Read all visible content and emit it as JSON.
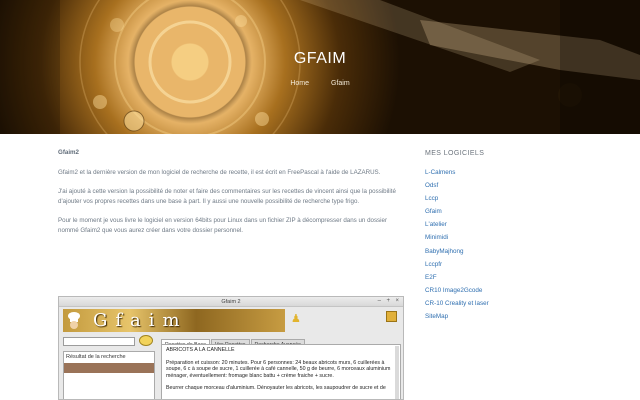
{
  "site": {
    "hero_title": "GFAIM",
    "breadcrumb": {
      "home": "Home",
      "current": "Gfaim"
    }
  },
  "post": {
    "title": "Gfaim2",
    "p1": "Gfaim2 et la dernière version de mon logiciel de recherche de recette, il est écrit en FreePascal à l'aide de LAZARUS.",
    "p2": "J'ai ajouté à cette version la possibilité de noter et faire des commentaires sur les recettes de vincent ainsi que la possibilité d'ajouter vos propres recettes dans une base à part. Il y aussi une nouvelle possibilité de recherche type frigo.",
    "p3": "Pour le moment je vous livre le logiciel en version 64bits pour Linux dans un fichier ZIP à décompresser dans un dossier nommé Gfaim2 que vous aurez créer dans votre dossier personnel."
  },
  "sidebar": {
    "heading": "MES LOGICIELS",
    "items": [
      "L-Calmens",
      "Odsf",
      "Lccp",
      "Gfaim",
      "L'atelier",
      "Minimidi",
      "BabyMajhong",
      "Lccpfr",
      "E2F",
      "CR10 Image2Gcode",
      "CR-10 Creality et laser",
      "SiteMap"
    ]
  },
  "app": {
    "window_title": "Gfaim 2",
    "window_controls": [
      "–",
      "+",
      "×"
    ],
    "banner_text": "Gfaim",
    "tabs": [
      "Recettes de Base",
      "Vos Recettes",
      "Recherche Avancée"
    ],
    "result_header": "Résultat de la recherche",
    "recipe_title": "ABRICOTS A LA CANNELLE",
    "recipe_p1": "Préparation et cuisson: 20 minutes. Pour 6 personnes: 24 beaux abricots murs, 6 cuillerées à soupe, 6 c à soupe de     sucre, 1 cuillerée à café cannelle, 50 g de beurre, 6 morceaux aluminium ménager, éventuellement: fromage blanc battu + crème fraiche + sucre.",
    "recipe_p2": "Beurrer chaque morceau d'aluminium. Dénoyauter les abricots, les saupoudrer de sucre et de"
  }
}
